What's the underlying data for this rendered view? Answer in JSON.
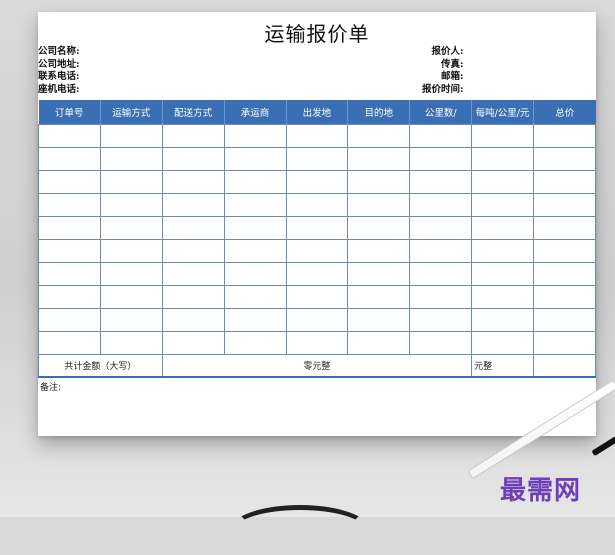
{
  "doc": {
    "title": "运输报价单",
    "info_left": [
      "公司名称:",
      "公司地址:",
      "联系电话:",
      "座机电话:"
    ],
    "info_right": [
      "报价人:",
      "传真:",
      "邮箱:",
      "报价时间:"
    ],
    "columns": [
      "订单号",
      "运输方式",
      "配送方式",
      "承运商",
      "出发地",
      "目的地",
      "公里数/",
      "每吨/公里/元",
      "总价"
    ],
    "empty_rows": 10,
    "total": {
      "label": "共计金额（大写）",
      "amount_text": "零元整",
      "amount_unit": "元整"
    },
    "note_label": "备注:"
  },
  "watermark": {
    "text": "最需网",
    "color": "#6e3fb8"
  },
  "colors": {
    "header_bg": "#3a6fb3",
    "grid_line": "#6f89b0"
  }
}
